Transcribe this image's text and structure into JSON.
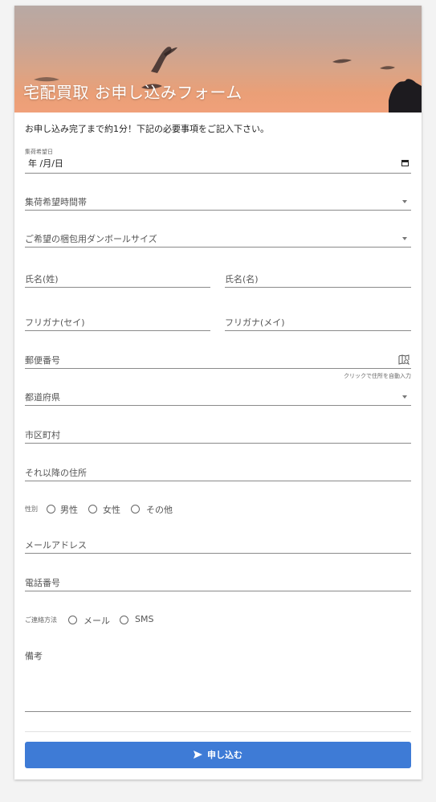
{
  "hero": {
    "title": "宅配買取 お申し込みフォーム"
  },
  "intro": "お申し込み完了まで約1分！下記の必要事項をご記入下さい。",
  "form": {
    "date": {
      "label": "集荷希望日",
      "value": "年 /月/日"
    },
    "time_slot": {
      "placeholder": "集荷希望時間帯"
    },
    "box_size": {
      "placeholder": "ご希望の梱包用ダンボールサイズ"
    },
    "last_name": {
      "placeholder": "氏名(姓)"
    },
    "first_name": {
      "placeholder": "氏名(名)"
    },
    "last_name_kana": {
      "placeholder": "フリガナ(セイ)"
    },
    "first_name_kana": {
      "placeholder": "フリガナ(メイ)"
    },
    "postal_code": {
      "placeholder": "郵便番号",
      "hint": "クリックで住所を自動入力"
    },
    "prefecture": {
      "placeholder": "都道府県"
    },
    "city": {
      "placeholder": "市区町村"
    },
    "address": {
      "placeholder": "それ以降の住所"
    },
    "gender": {
      "label": "性別",
      "options": [
        "男性",
        "女性",
        "その他"
      ]
    },
    "email": {
      "placeholder": "メールアドレス"
    },
    "phone": {
      "placeholder": "電話番号"
    },
    "contact": {
      "label": "ご連絡方法",
      "options": [
        "メール",
        "SMS"
      ]
    },
    "notes": {
      "placeholder": "備考"
    },
    "submit_label": "申し込む"
  },
  "colors": {
    "accent": "#3e7bd6",
    "hero_top": "#b8a9a4",
    "hero_bottom": "#f0a07a"
  },
  "icons": {
    "calendar": "calendar-icon",
    "map": "map-search-icon",
    "send": "send-icon",
    "dropdown": "chevron-down-icon"
  }
}
